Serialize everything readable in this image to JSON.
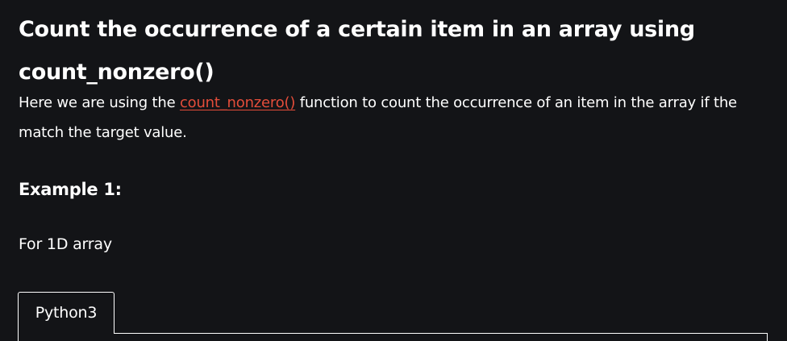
{
  "article": {
    "heading": "Count the occurrence of a certain item in an array using count_nonzero()",
    "intro": {
      "before_link": "Here we are using the ",
      "link_text": "count_nonzero()",
      "after_link": " function to count the occurrence of an item in the array if the match the target value."
    },
    "example_heading": "Example 1:",
    "example_caption": "For 1D array"
  },
  "code_block": {
    "tabs": [
      {
        "label": "Python3",
        "active": true
      }
    ]
  },
  "colors": {
    "background": "#131417",
    "text": "#ffffff",
    "link": "#e44d3a"
  }
}
